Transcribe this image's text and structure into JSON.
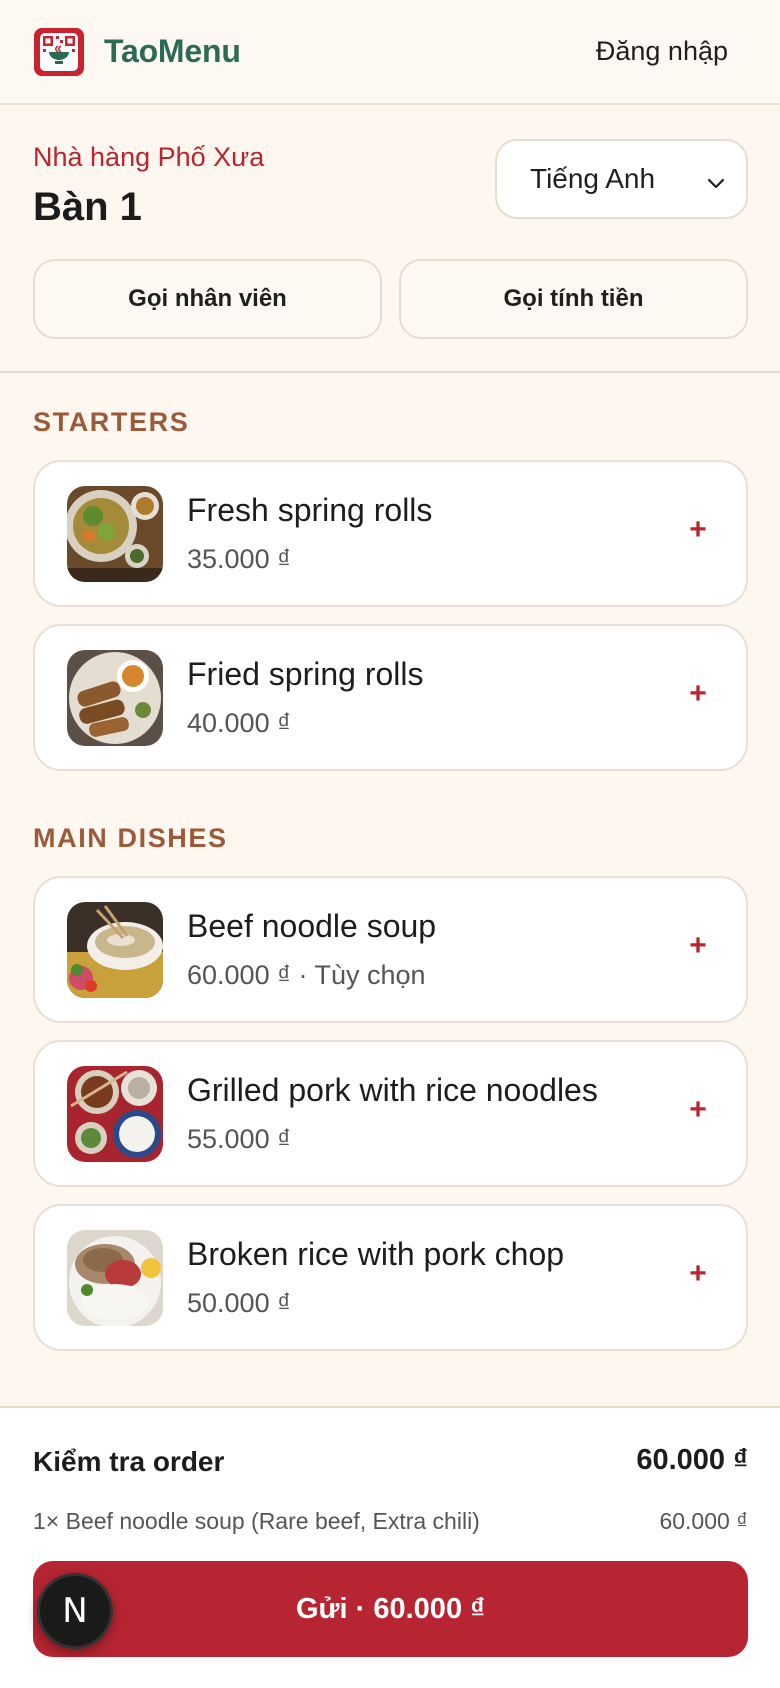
{
  "header": {
    "brand": "TaoMenu",
    "login_label": "Đăng nhập",
    "logo_icon": "qr-menu-logo-icon"
  },
  "restaurant": {
    "name": "Nhà hàng Phố Xưa",
    "table": "Bàn 1",
    "language": "Tiếng Anh",
    "call_staff": "Gọi nhân viên",
    "call_bill": "Gọi tính tiền"
  },
  "categories": [
    {
      "title": "STARTERS",
      "items": [
        {
          "name": "Fresh spring rolls",
          "price": "35.000 ₫",
          "add": "+"
        },
        {
          "name": "Fried spring rolls",
          "price": "40.000 ₫",
          "add": "+"
        }
      ]
    },
    {
      "title": "MAIN DISHES",
      "items": [
        {
          "name": "Beef noodle soup",
          "price": "60.000 ₫ · Tùy chọn",
          "add": "+"
        },
        {
          "name": "Grilled pork with rice noodles",
          "price": "55.000 ₫",
          "add": "+"
        },
        {
          "name": "Broken rice with pork chop",
          "price": "50.000 ₫",
          "add": "+"
        }
      ]
    }
  ],
  "order": {
    "title": "Kiểm tra order",
    "total": "60.000 ₫",
    "lines": [
      {
        "text": "1× Beef noodle soup (Rare beef, Extra chili)",
        "price": "60.000 ₫"
      }
    ],
    "submit_label": "Gửi · 60.000 ₫"
  },
  "dev_badge": "N",
  "colors": {
    "accent_red": "#b82532",
    "brand_green": "#2d6a55",
    "category_brown": "#9b5a3a",
    "background": "#fdf7f0"
  }
}
